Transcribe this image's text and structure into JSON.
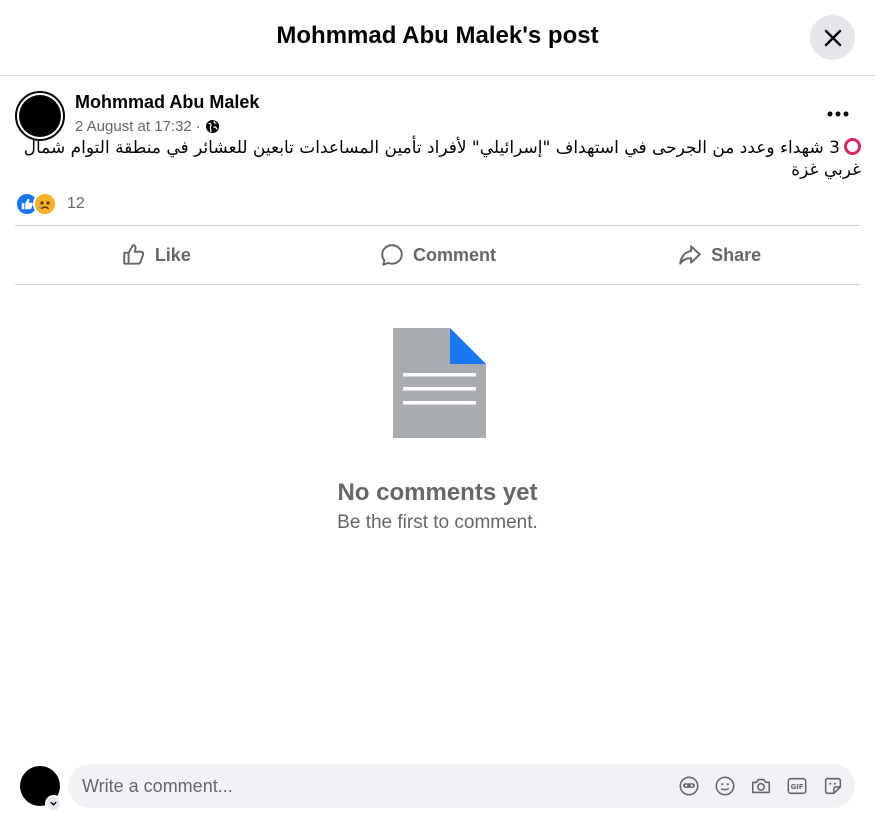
{
  "header": {
    "title": "Mohmmad Abu Malek's post",
    "close_icon": "close-icon"
  },
  "post": {
    "author": "Mohmmad Abu Malek",
    "date": "2 August at 17:32",
    "separator": "·",
    "privacy_icon": "globe-icon",
    "more_icon": "more-horizontal-icon",
    "text": "3 شهداء وعدد من الجرحى في استهداف \"إسرائيلي\" لأفراد تأمين المساعدات تابعين للعشائر في منطقة التوام شمال غربي غزة",
    "text_marker_icon": "red-ring-icon",
    "reactions": {
      "icons": [
        "like-reaction-icon",
        "sad-reaction-icon"
      ],
      "count": "12"
    }
  },
  "actions": {
    "like_label": "Like",
    "comment_label": "Comment",
    "share_label": "Share"
  },
  "comments": {
    "empty_icon": "document-icon",
    "empty_title": "No comments yet",
    "empty_subtitle": "Be the first to comment."
  },
  "composer": {
    "placeholder": "Write a comment...",
    "tools": [
      "avatar-sticker-icon",
      "emoji-icon",
      "camera-icon",
      "gif-icon",
      "sticker-icon"
    ]
  },
  "colors": {
    "accent": "#1877f2",
    "text_primary": "#050505",
    "text_secondary": "#65676b",
    "divider": "#ced0d4",
    "input_bg": "#f0f2f5",
    "marker": "#e0245e"
  }
}
